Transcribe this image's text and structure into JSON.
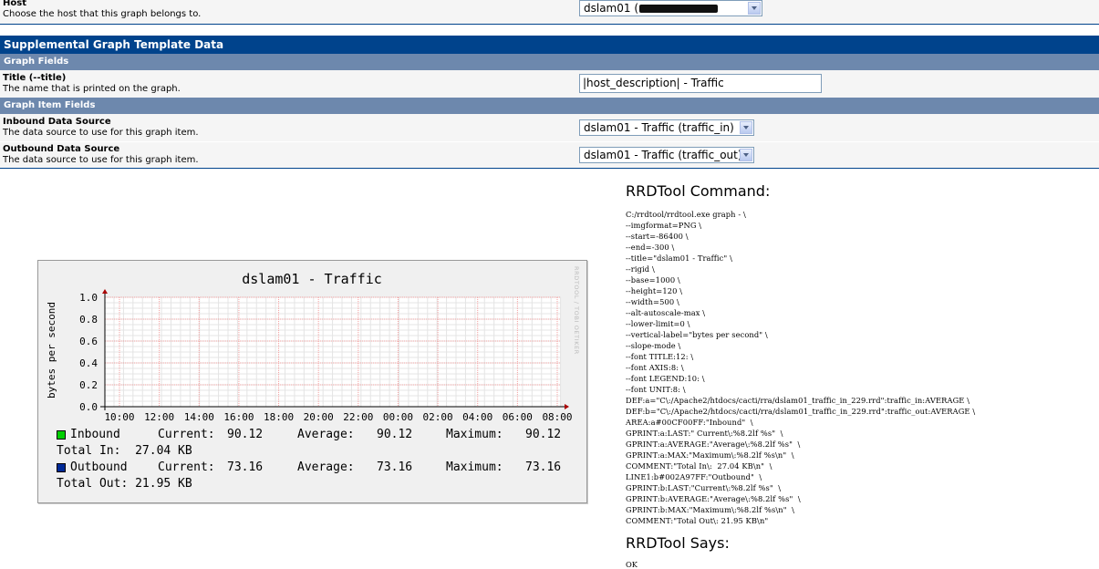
{
  "host": {
    "title": "Host",
    "description": "Choose the host that this graph belongs to.",
    "value_prefix": "dslam01 ("
  },
  "supplemental_header": "Supplemental Graph Template Data",
  "graph_fields_header": "Graph Fields",
  "title_field": {
    "title": "Title (--title)",
    "description": "The name that is printed on the graph.",
    "value": "|host_description| - Traffic"
  },
  "graph_item_fields_header": "Graph Item Fields",
  "inbound": {
    "title": "Inbound Data Source",
    "description": "The data source to use for this graph item.",
    "value": "dslam01 - Traffic (traffic_in)"
  },
  "outbound": {
    "title": "Outbound Data Source",
    "description": "The data source to use for this graph item.",
    "value": "dslam01 - Traffic (traffic_out)"
  },
  "graph": {
    "watermark": "RRDTOOL / TOBI OETIKER"
  },
  "chart_data": {
    "type": "area",
    "title": "dslam01 - Traffic",
    "ylabel": "bytes per second",
    "xlabel": "",
    "ylim": [
      0,
      1.0
    ],
    "yticks": [
      "0.0",
      "0.2",
      "0.4",
      "0.6",
      "0.8",
      "1.0"
    ],
    "categories": [
      "10:00",
      "12:00",
      "14:00",
      "16:00",
      "18:00",
      "20:00",
      "22:00",
      "00:00",
      "02:00",
      "04:00",
      "06:00",
      "08:00"
    ],
    "grid": true,
    "series": [
      {
        "name": "Inbound",
        "color": "#00CF00",
        "current": "90.12",
        "average": "90.12",
        "maximum": "90.12",
        "total": "Total In:  27.04 KB"
      },
      {
        "name": "Outbound",
        "color": "#002A97",
        "current": "73.16",
        "average": "73.16",
        "maximum": "73.16",
        "total": "Total Out: 21.95 KB"
      }
    ],
    "legend_labels": {
      "current": "Current:",
      "average": "Average:",
      "maximum": "Maximum:"
    }
  },
  "rrdtool_command_title": "RRDTool Command:",
  "rrdtool_command_lines": [
    "C:/rrdtool/rrdtool.exe graph - \\",
    "--imgformat=PNG \\",
    "--start=-86400 \\",
    "--end=-300 \\",
    "--title=\"dslam01 - Traffic\" \\",
    "--rigid \\",
    "--base=1000 \\",
    "--height=120 \\",
    "--width=500 \\",
    "--alt-autoscale-max \\",
    "--lower-limit=0 \\",
    "--vertical-label=\"bytes per second\" \\",
    "--slope-mode \\",
    "--font TITLE:12: \\",
    "--font AXIS:8: \\",
    "--font LEGEND:10: \\",
    "--font UNIT:8: \\",
    "DEF:a=\"C\\:/Apache2/htdocs/cacti/rra/dslam01_traffic_in_229.rrd\":traffic_in:AVERAGE \\",
    "DEF:b=\"C\\:/Apache2/htdocs/cacti/rra/dslam01_traffic_in_229.rrd\":traffic_out:AVERAGE \\",
    "AREA:a#00CF00FF:\"Inbound\"  \\",
    "GPRINT:a:LAST:\" Current\\:%8.2lf %s\"  \\",
    "GPRINT:a:AVERAGE:\"Average\\:%8.2lf %s\"  \\",
    "GPRINT:a:MAX:\"Maximum\\:%8.2lf %s\\n\"  \\",
    "COMMENT:\"Total In\\:  27.04 KB\\n\"  \\",
    "LINE1:b#002A97FF:\"Outbound\"  \\",
    "GPRINT:b:LAST:\"Current\\:%8.2lf %s\"  \\",
    "GPRINT:b:AVERAGE:\"Average\\:%8.2lf %s\"  \\",
    "GPRINT:b:MAX:\"Maximum\\:%8.2lf %s\\n\"  \\",
    "COMMENT:\"Total Out\\: 21.95 KB\\n\""
  ],
  "rrdtool_says_title": "RRDTool Says:",
  "rrdtool_says": "OK"
}
